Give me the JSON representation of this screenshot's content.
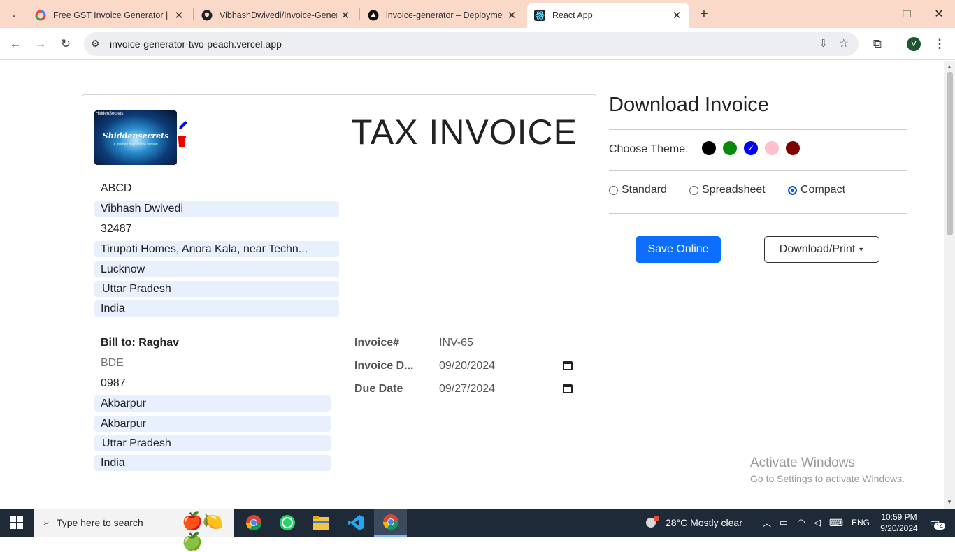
{
  "browser": {
    "tabs": [
      {
        "title": "Free GST Invoice Generator | Fre",
        "icon": "google-icon"
      },
      {
        "title": "VibhashDwivedi/Invoice-Genera",
        "icon": "github-icon"
      },
      {
        "title": "invoice-generator – Deployment",
        "icon": "vercel-icon"
      },
      {
        "title": "React App",
        "icon": "react-icon",
        "active": true
      }
    ],
    "url": "invoice-generator-two-peach.vercel.app",
    "profile_initial": "V"
  },
  "invoice": {
    "title": "TAX INVOICE",
    "logo": {
      "top_text": "HiddenSecrets",
      "name": "Shiddensecrets",
      "sub": "a journey beyond the screen"
    },
    "from": {
      "company": "ABCD",
      "name": "Vibhash Dwivedi",
      "phone": "32487",
      "address": "Tirupati Homes, Anora Kala, near Techn...",
      "city": "Lucknow",
      "state": "Uttar Pradesh",
      "country": "India"
    },
    "bill_to": {
      "label": "Bill to: Raghav",
      "designation": "BDE",
      "phone": "0987",
      "address1": "Akbarpur",
      "address2": "Akbarpur",
      "state": "Uttar Pradesh",
      "country": "India"
    },
    "meta": {
      "invoice_no_label": "Invoice#",
      "invoice_no": "INV-65",
      "invoice_date_label": "Invoice D...",
      "invoice_date": "09/20/2024",
      "due_date_label": "Due Date",
      "due_date": "09/27/2024"
    }
  },
  "sidebar": {
    "title": "Download Invoice",
    "theme_label": "Choose Theme:",
    "themes": [
      "#000000",
      "#0a8a0a",
      "#0000ff",
      "#ffc0cb",
      "#800000"
    ],
    "selected_theme": "#0000ff",
    "layouts": [
      "Standard",
      "Spreadsheet",
      "Compact"
    ],
    "selected_layout": "Compact",
    "save_label": "Save Online",
    "download_label": "Download/Print"
  },
  "watermark": {
    "line1": "Activate Windows",
    "line2": "Go to Settings to activate Windows."
  },
  "taskbar": {
    "search_placeholder": "Type here to search",
    "weather": "28°C  Mostly clear",
    "lang": "ENG",
    "time": "10:59 PM",
    "date": "9/20/2024",
    "notif_count": "14"
  }
}
